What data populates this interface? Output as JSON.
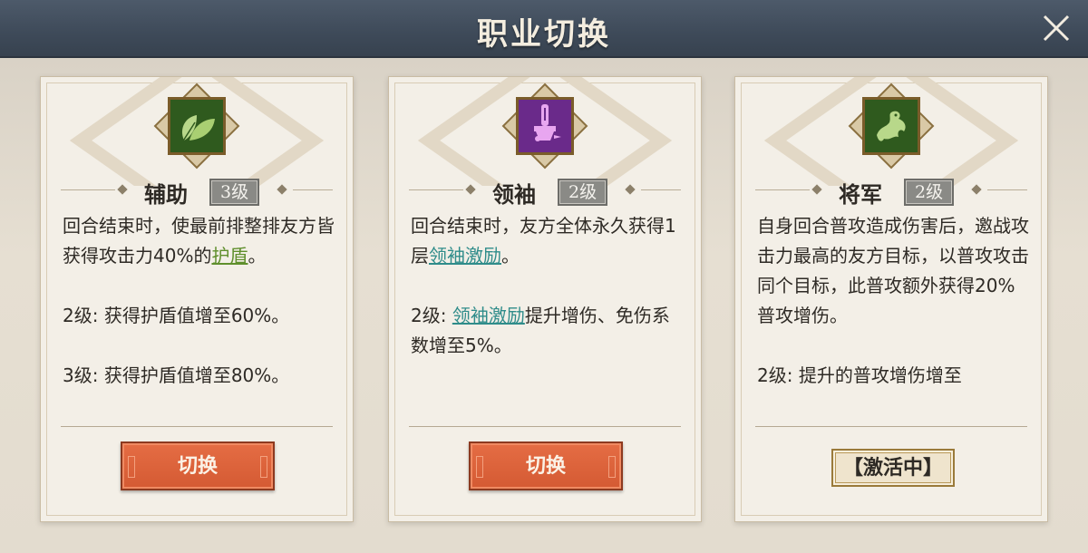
{
  "header": {
    "title": "职业切换"
  },
  "cards": [
    {
      "name": "辅助",
      "level": "3级",
      "emblem_color": "#2f5a1e",
      "icon": "leaf-icon",
      "desc": {
        "p1_a": "回合结束时，使最前排整排友方皆获得攻击力40%的",
        "p1_kw": "护盾",
        "p1_b": "。",
        "p2": "2级: 获得护盾值增至60%。",
        "p3": "3级: 获得护盾值增至80%。"
      },
      "button": "切换"
    },
    {
      "name": "领袖",
      "level": "2级",
      "emblem_color": "#6a2a8a",
      "icon": "banner-icon",
      "desc": {
        "p1_a": "回合结束时，友方全体永久获得1层",
        "p1_kw": "领袖激励",
        "p1_b": "。",
        "p2_pre": "2级: ",
        "p2_kw": "领袖激励",
        "p2_b": "提升增伤、免伤系数增至5%。"
      },
      "button": "切换"
    },
    {
      "name": "将军",
      "level": "2级",
      "emblem_color": "#2f5a1e",
      "icon": "dragon-icon",
      "desc": {
        "p1": "自身回合普攻造成伤害后，邀战攻击力最高的友方目标，以普攻攻击同个目标，此普攻额外获得20%普攻增伤。",
        "p2": "2级: 提升的普攻增伤增至"
      },
      "status": "【激活中】"
    }
  ]
}
